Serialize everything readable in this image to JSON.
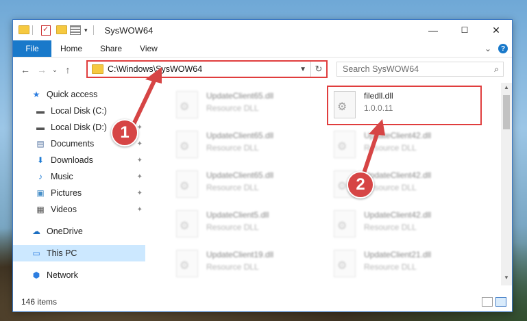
{
  "window": {
    "title": "SysWOW64",
    "controls": {
      "minimize": "—",
      "maximize": "☐",
      "close": "✕"
    }
  },
  "ribbon": {
    "tabs": [
      "File",
      "Home",
      "Share",
      "View"
    ],
    "collapse_icon": "⌄",
    "help_icon": "?"
  },
  "navigation": {
    "back": "←",
    "forward": "→",
    "recent": "⌄",
    "up": "↑",
    "address": "C:\\Windows\\SysWOW64",
    "refresh": "↻",
    "search_placeholder": "Search SysWOW64",
    "search_icon": "⌕"
  },
  "sidebar": {
    "items": [
      {
        "label": "Quick access",
        "icon": "star-icon",
        "glyph": "★",
        "color": "#2d7ee0",
        "pinned": false
      },
      {
        "label": "Local Disk (C:)",
        "icon": "drive-icon",
        "glyph": "▬",
        "color": "#555555",
        "pinned": true
      },
      {
        "label": "Local Disk (D:)",
        "icon": "drive-icon",
        "glyph": "▬",
        "color": "#555555",
        "pinned": true
      },
      {
        "label": "Documents",
        "icon": "documents-icon",
        "glyph": "▤",
        "color": "#5b7aa6",
        "pinned": true
      },
      {
        "label": "Downloads",
        "icon": "downloads-icon",
        "glyph": "⬇",
        "color": "#1e7bd4",
        "pinned": true
      },
      {
        "label": "Music",
        "icon": "music-icon",
        "glyph": "♪",
        "color": "#1e7bd4",
        "pinned": true
      },
      {
        "label": "Pictures",
        "icon": "pictures-icon",
        "glyph": "▣",
        "color": "#4a90c8",
        "pinned": true
      },
      {
        "label": "Videos",
        "icon": "videos-icon",
        "glyph": "▦",
        "color": "#555555",
        "pinned": true
      },
      {
        "label": "OneDrive",
        "icon": "onedrive-icon",
        "glyph": "☁",
        "color": "#1b6ec2",
        "pinned": false
      },
      {
        "label": "This PC",
        "icon": "computer-icon",
        "glyph": "▭",
        "color": "#2d7ee0",
        "pinned": false
      },
      {
        "label": "Network",
        "icon": "network-icon",
        "glyph": "⬢",
        "color": "#2d7ee0",
        "pinned": false
      }
    ],
    "pin_glyph": "📌"
  },
  "files": [
    {
      "name": "UpdateClient65.dll",
      "desc": "Resource DLL",
      "highlight": false
    },
    {
      "name": "filedll.dll",
      "desc": "1.0.0.11",
      "highlight": true
    },
    {
      "name": "UpdateClient65.dll",
      "desc": "Resource DLL",
      "highlight": false
    },
    {
      "name": "UpdateClient42.dll",
      "desc": "Resource DLL",
      "highlight": false
    },
    {
      "name": "UpdateClient65.dll",
      "desc": "Resource DLL",
      "highlight": false
    },
    {
      "name": "UpdateClient42.dll",
      "desc": "Resource DLL",
      "highlight": false
    },
    {
      "name": "UpdateClient5.dll",
      "desc": "Resource DLL",
      "highlight": false
    },
    {
      "name": "UpdateClient42.dll",
      "desc": "Resource DLL",
      "highlight": false
    },
    {
      "name": "UpdateClient19.dll",
      "desc": "Resource DLL",
      "highlight": false
    },
    {
      "name": "UpdateClient21.dll",
      "desc": "Resource DLL",
      "highlight": false
    }
  ],
  "status": {
    "count": "146 items"
  },
  "annotations": {
    "badge1": "1",
    "badge2": "2",
    "color": "#d64545"
  }
}
